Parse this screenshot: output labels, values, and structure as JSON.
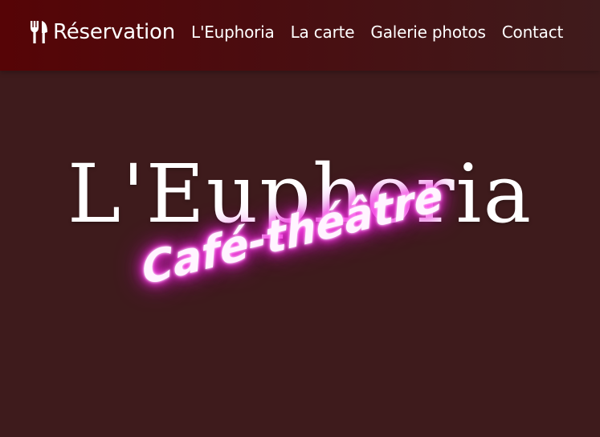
{
  "navbar": {
    "brand": {
      "icon": "utensils-icon",
      "label": "Réservation"
    },
    "links": [
      {
        "label": "L'Euphoria"
      },
      {
        "label": "La carte"
      },
      {
        "label": "Galerie photos"
      },
      {
        "label": "Contact"
      }
    ]
  },
  "hero": {
    "title": "L'Euphoria",
    "subtitle": "Café-théâtre"
  },
  "colors": {
    "navbar_start": "#560406",
    "navbar_end": "#3f1b1c",
    "background": "#3e1b1c",
    "neon_glow": "#ff2fe6",
    "text": "#ffffff"
  }
}
